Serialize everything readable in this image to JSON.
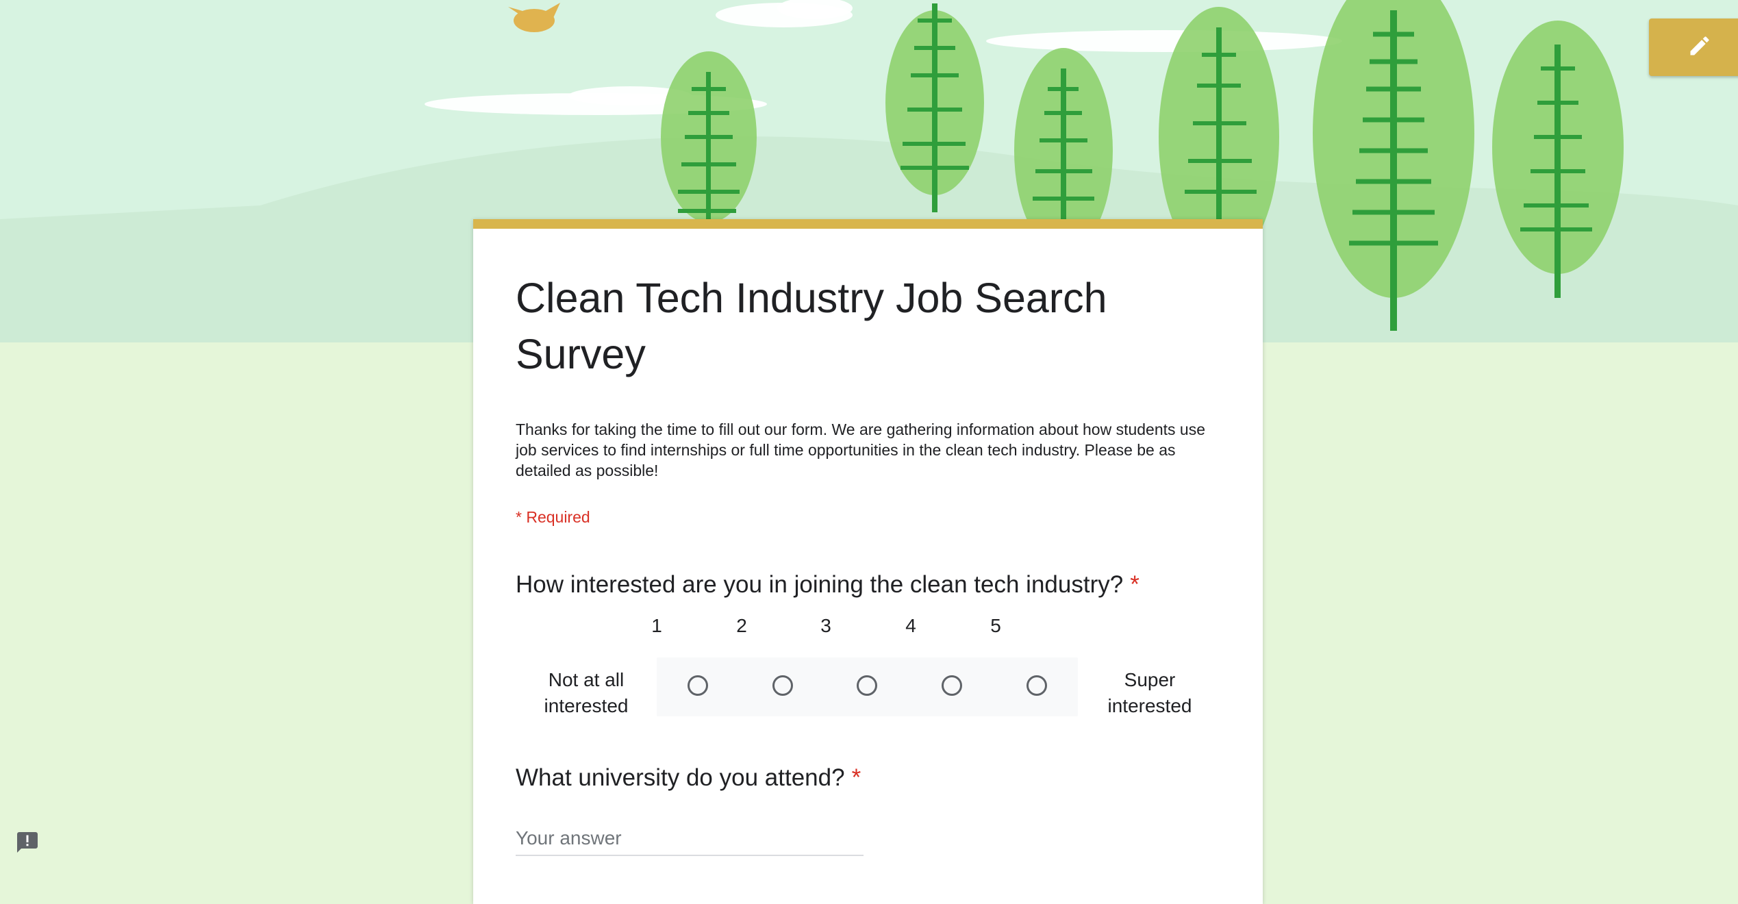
{
  "form": {
    "title": "Clean Tech Industry Job Search Survey",
    "description": "Thanks for taking the time to fill out our form. We are gathering information about how students use job services to find internships or full time opportunities in the clean tech industry. Please be as detailed as possible!",
    "required_note": "* Required"
  },
  "questions": [
    {
      "title": "How interested are you in joining the clean tech industry?",
      "required_mark": "*",
      "type": "linear-scale",
      "scale": [
        "1",
        "2",
        "3",
        "4",
        "5"
      ],
      "low_label": "Not at all interested",
      "high_label": "Super interested"
    },
    {
      "title": "What university do you attend?",
      "required_mark": "*",
      "type": "short-answer",
      "placeholder": "Your answer",
      "value": ""
    }
  ],
  "toolbar": {
    "edit_icon": "pencil-icon"
  },
  "footer": {
    "feedback_icon": "report-icon"
  },
  "colors": {
    "accent": "#d8b54c",
    "required": "#d93025",
    "header_bg": "#d7f3e1",
    "page_bg": "#e5f6d9"
  }
}
